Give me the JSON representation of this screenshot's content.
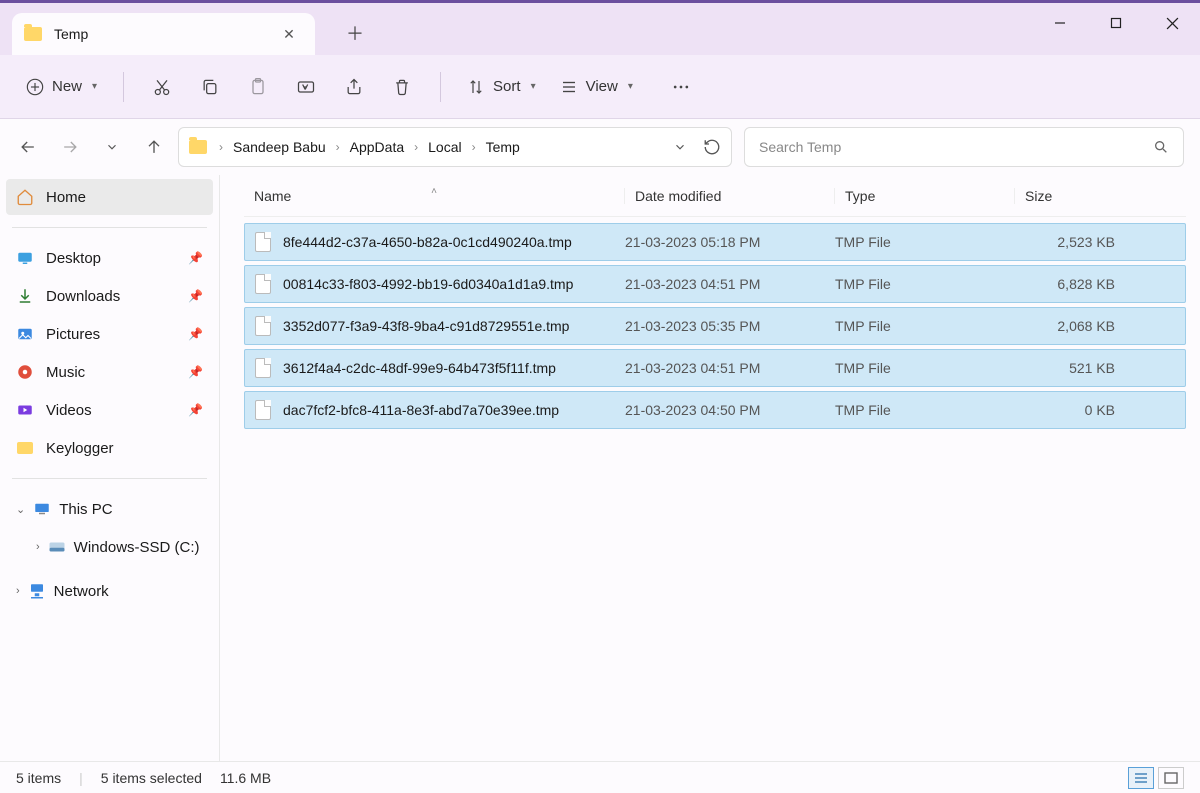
{
  "tab": {
    "title": "Temp"
  },
  "toolbar": {
    "new_label": "New",
    "sort_label": "Sort",
    "view_label": "View"
  },
  "breadcrumb": [
    "Sandeep Babu",
    "AppData",
    "Local",
    "Temp"
  ],
  "search": {
    "placeholder": "Search Temp"
  },
  "sidebar": {
    "home": "Home",
    "quick": [
      {
        "label": "Desktop"
      },
      {
        "label": "Downloads"
      },
      {
        "label": "Pictures"
      },
      {
        "label": "Music"
      },
      {
        "label": "Videos"
      },
      {
        "label": "Keylogger"
      }
    ],
    "thispc": "This PC",
    "drive": "Windows-SSD (C:)",
    "network": "Network"
  },
  "columns": {
    "name": "Name",
    "date": "Date modified",
    "type": "Type",
    "size": "Size"
  },
  "files": [
    {
      "name": "8fe444d2-c37a-4650-b82a-0c1cd490240a.tmp",
      "date": "21-03-2023 05:18 PM",
      "type": "TMP File",
      "size": "2,523 KB"
    },
    {
      "name": "00814c33-f803-4992-bb19-6d0340a1d1a9.tmp",
      "date": "21-03-2023 04:51 PM",
      "type": "TMP File",
      "size": "6,828 KB"
    },
    {
      "name": "3352d077-f3a9-43f8-9ba4-c91d8729551e.tmp",
      "date": "21-03-2023 05:35 PM",
      "type": "TMP File",
      "size": "2,068 KB"
    },
    {
      "name": "3612f4a4-c2dc-48df-99e9-64b473f5f11f.tmp",
      "date": "21-03-2023 04:51 PM",
      "type": "TMP File",
      "size": "521 KB"
    },
    {
      "name": "dac7fcf2-bfc8-411a-8e3f-abd7a70e39ee.tmp",
      "date": "21-03-2023 04:50 PM",
      "type": "TMP File",
      "size": "0 KB"
    }
  ],
  "status": {
    "count": "5 items",
    "selection": "5 items selected",
    "size": "11.6 MB"
  }
}
